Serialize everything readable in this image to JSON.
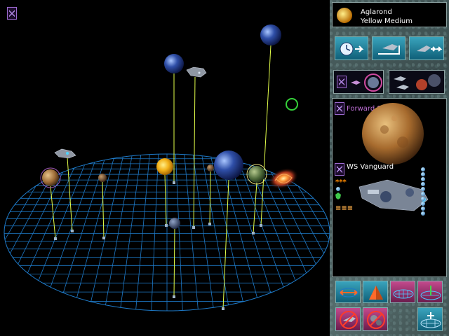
{
  "star_system": {
    "name": "Aglarond",
    "star_type": "Yellow Medium"
  },
  "selected_planet": {
    "name": "Forward Station"
  },
  "selected_ship": {
    "name": "WS Vanguard",
    "rank_marks": "***",
    "ammo_marks": "≡≡≡"
  },
  "colors": {
    "grid": "#1e7ac8",
    "stalk": "#e4ff4a",
    "selection_ring": "#35d13a",
    "panel_text": "#ffffff",
    "planet_label": "#c070d8",
    "ship_label": "#ffffff",
    "rank": "#ff8a00"
  },
  "icons": {
    "star": "sun-icon",
    "time": "clock-advance-icon",
    "fleet": "fleet-move-icon",
    "ships": "ships-fast-icon",
    "orbit": "planet-orbit-icon",
    "attack": "attack-ships-icon",
    "rotate": "rotate-arrows-icon",
    "tilt": "tilt-cone-icon",
    "grid_flat": "grid-flat-icon",
    "grid_axis": "grid-axis-icon",
    "no_ships": "no-ships-icon",
    "no_planets": "no-planets-icon",
    "zoom": "zoom-grid-icon"
  }
}
